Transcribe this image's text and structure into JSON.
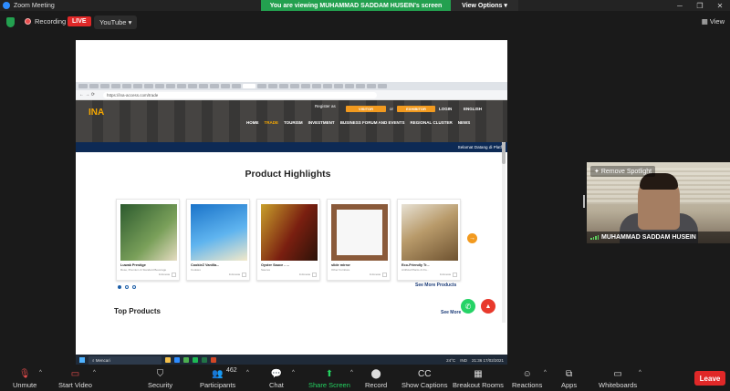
{
  "window": {
    "title": "Zoom Meeting"
  },
  "banner": {
    "message": "You are viewing MUHAMMAD SADDAM HUSEIN's screen",
    "view_options": "View Options"
  },
  "topbar": {
    "recording": "Recording",
    "live": "LIVE",
    "stream": "YouTube",
    "view": "View"
  },
  "browser": {
    "url": "https://ina-access.com/trade"
  },
  "site": {
    "logo": "INA",
    "register": "Register as",
    "visitor": "VISITOR",
    "or": "or",
    "exhibitor": "EXHIBITOR",
    "login": "LOGIN",
    "language": "ENGLISH",
    "menu": [
      "HOME",
      "TRADE",
      "TOURISM",
      "INVESTMENT",
      "BUSINESS FORUM AND EVENTS",
      "REGIONAL CLUSTER",
      "NEWS"
    ],
    "strip": "Selamat Datang di Platfor",
    "highlights_title": "Product Highlights",
    "products": [
      {
        "name": "Luwak Prestige",
        "sub": "Rose, Premium & Standard Beverage",
        "tag": "Indonesia"
      },
      {
        "name": "CookieZ Vanilla...",
        "sub": "Cookies",
        "tag": "Indonesia"
      },
      {
        "name": "Oyster Sauce - ...",
        "sub": "Sauces",
        "tag": "Indonesia"
      },
      {
        "name": "slide mirror",
        "sub": "Other Furniture",
        "tag": "Indonesia"
      },
      {
        "name": "Eco-Friendly Tr...",
        "sub": "Artificial Plants & Flo...",
        "tag": "Indonesia"
      }
    ],
    "see_more_products": "See More Products",
    "top_products": "Top Products",
    "see_more": "See More"
  },
  "taskbar": {
    "search": "Mencari",
    "temp": "24°C",
    "lang": "IND",
    "time": "21:36",
    "date": "17/02/2021"
  },
  "video": {
    "spotlight": "Remove Spotlight",
    "name": "MUHAMMAD SADDAM HUSEIN"
  },
  "toolbar": {
    "unmute": "Unmute",
    "start_video": "Start Video",
    "security": "Security",
    "participants": "Participants",
    "participants_count": "462",
    "chat": "Chat",
    "share_screen": "Share Screen",
    "record": "Record",
    "captions": "Show Captions",
    "breakout": "Breakout Rooms",
    "reactions": "Reactions",
    "apps": "Apps",
    "whiteboards": "Whiteboards",
    "leave": "Leave"
  },
  "colors": {
    "accent": "#2d8cff",
    "live": "#e02828",
    "share_green": "#23a04f",
    "site_orange": "#f29a1f",
    "site_navy": "#0d2a55"
  }
}
